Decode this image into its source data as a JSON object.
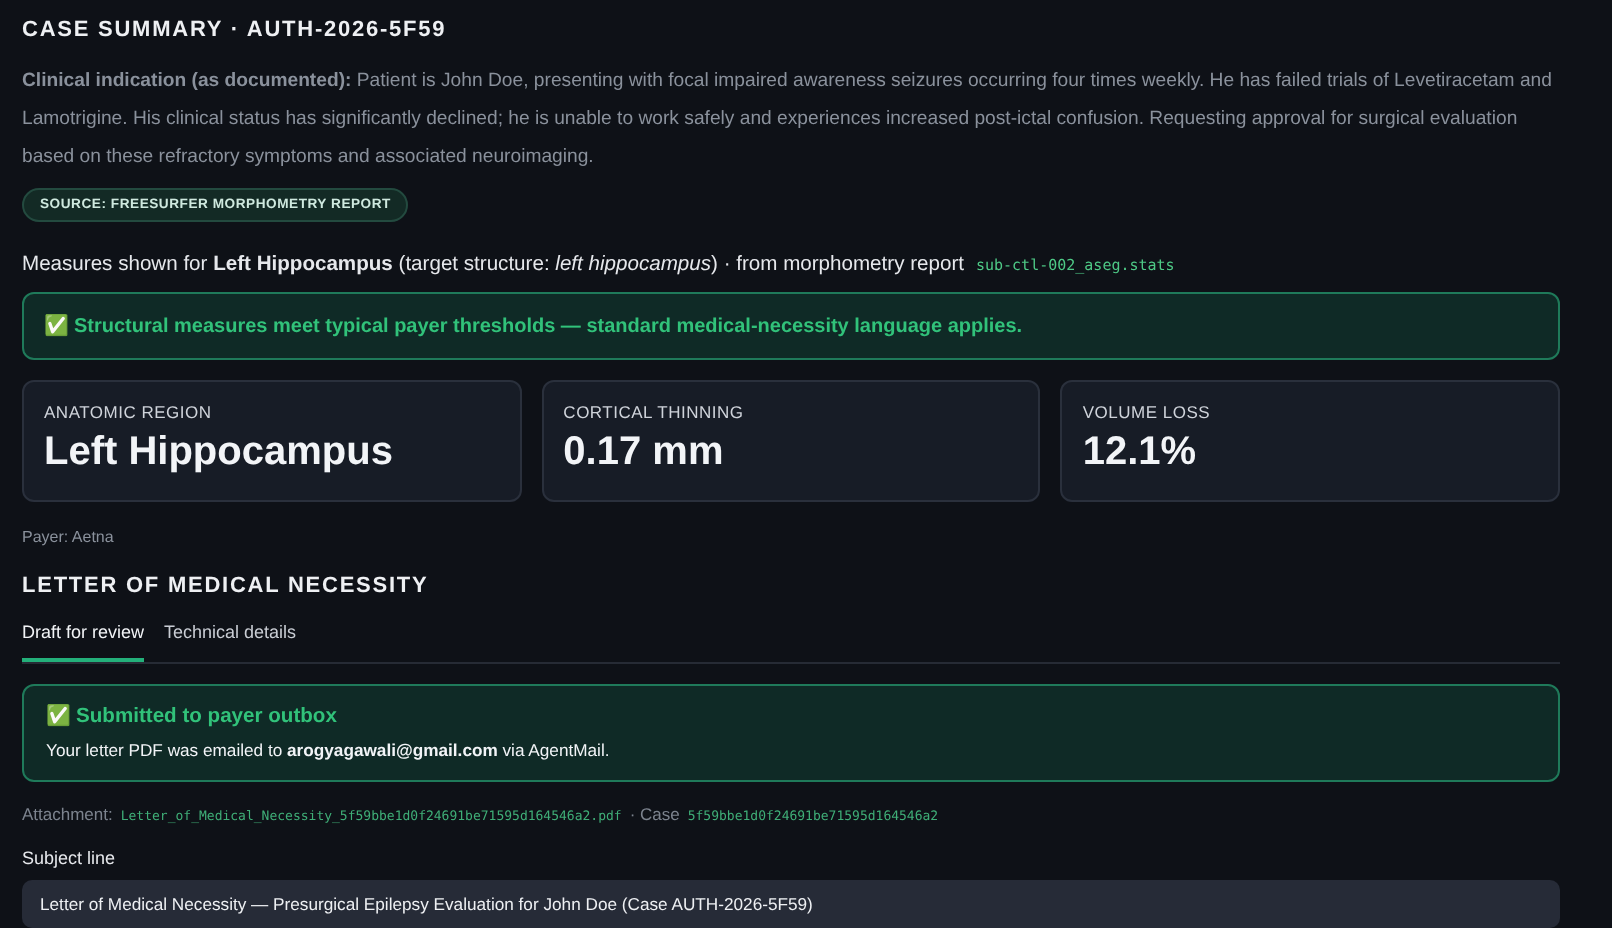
{
  "heading": "CASE SUMMARY · AUTH-2026-5F59",
  "indication": {
    "label": "Clinical indication (as documented):",
    "text": "Patient is John Doe, presenting with focal impaired awareness seizures occurring four times weekly. He has failed trials of Levetiracetam and Lamotrigine. His clinical status has significantly declined; he is unable to work safely and experiences increased post-ictal confusion. Requesting approval for surgical evaluation based on these refractory symptoms and associated neuroimaging."
  },
  "source_badge": "SOURCE: FREESURFER MORPHOMETRY REPORT",
  "measures_line": {
    "text": "Measures shown for **Left Hippocampus** (target structure: *left hippocampus*) · from morphometry report",
    "file": "sub-ctl-002_aseg.stats"
  },
  "threshold_banner": {
    "icon": "✅",
    "text": "Structural measures meet typical payer thresholds — standard medical-necessity language applies."
  },
  "metrics": [
    {
      "label": "ANATOMIC REGION",
      "value": "Left Hippocampus"
    },
    {
      "label": "CORTICAL THINNING",
      "value": "0.17 mm"
    },
    {
      "label": "VOLUME LOSS",
      "value": "12.1%"
    }
  ],
  "payer": "Payer: Aetna",
  "letter_heading": "LETTER OF MEDICAL NECESSITY",
  "tabs": [
    {
      "label": "Draft for review",
      "selected": true
    },
    {
      "label": "Technical details",
      "selected": false
    }
  ],
  "success": {
    "icon": "✅",
    "title": "Submitted to payer outbox",
    "text": "Your letter PDF was emailed to **arogyagawali@gmail.com** via AgentMail."
  },
  "attachment": {
    "label": "Attachment:",
    "file": "Letter_of_Medical_Necessity_5f59bbe1d0f24691be71595d164546a2.pdf",
    "case_label": "· Case",
    "case_id": "5f59bbe1d0f24691be71595d164546a2"
  },
  "subject": {
    "label": "Subject line",
    "value": "Letter of Medical Necessity — Presurgical Epilepsy Evaluation for John Doe (Case AUTH-2026-5F59)"
  }
}
